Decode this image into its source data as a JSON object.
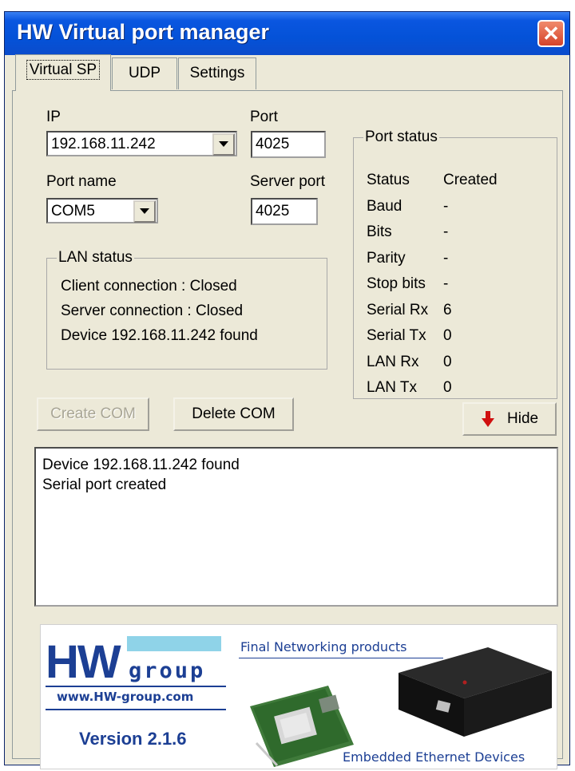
{
  "window": {
    "title": "HW Virtual port manager"
  },
  "tabs": [
    {
      "label": "Virtual SP",
      "active": true
    },
    {
      "label": "UDP",
      "active": false
    },
    {
      "label": "Settings",
      "active": false
    }
  ],
  "form": {
    "ip_label": "IP",
    "ip_value": "192.168.11.242",
    "port_label": "Port",
    "port_value": "4025",
    "port_name_label": "Port name",
    "port_name_value": "COM5",
    "server_port_label": "Server port",
    "server_port_value": "4025"
  },
  "lan_status": {
    "title": "LAN status",
    "lines": [
      "Client connection  : Closed",
      "Server connection : Closed",
      "Device 192.168.11.242 found"
    ]
  },
  "port_status": {
    "title": "Port status",
    "rows": [
      {
        "key": "Status",
        "value": "Created"
      },
      {
        "key": "Baud",
        "value": "-"
      },
      {
        "key": "Bits",
        "value": "-"
      },
      {
        "key": "Parity",
        "value": "-"
      },
      {
        "key": "Stop bits",
        "value": "-"
      },
      {
        "key": "Serial Rx",
        "value": "6"
      },
      {
        "key": "Serial Tx",
        "value": "0"
      },
      {
        "key": "LAN Rx",
        "value": "0"
      },
      {
        "key": "LAN Tx",
        "value": "0"
      }
    ]
  },
  "buttons": {
    "create_com": "Create COM",
    "delete_com": "Delete COM",
    "hide": "Hide"
  },
  "log": {
    "lines": [
      "Device 192.168.11.242 found",
      "Serial port created"
    ]
  },
  "banner": {
    "logo_hw": "HW",
    "logo_group": "group",
    "website": "www.HW-group.com",
    "version": "Version 2.1.6",
    "tagline_top": "Final Networking products",
    "tagline_bottom": "Embedded Ethernet Devices"
  },
  "colors": {
    "title_bar": "#0452d8",
    "close_button": "#d5432a",
    "logo_blue": "#1c3f94",
    "hide_arrow": "#d01010"
  }
}
